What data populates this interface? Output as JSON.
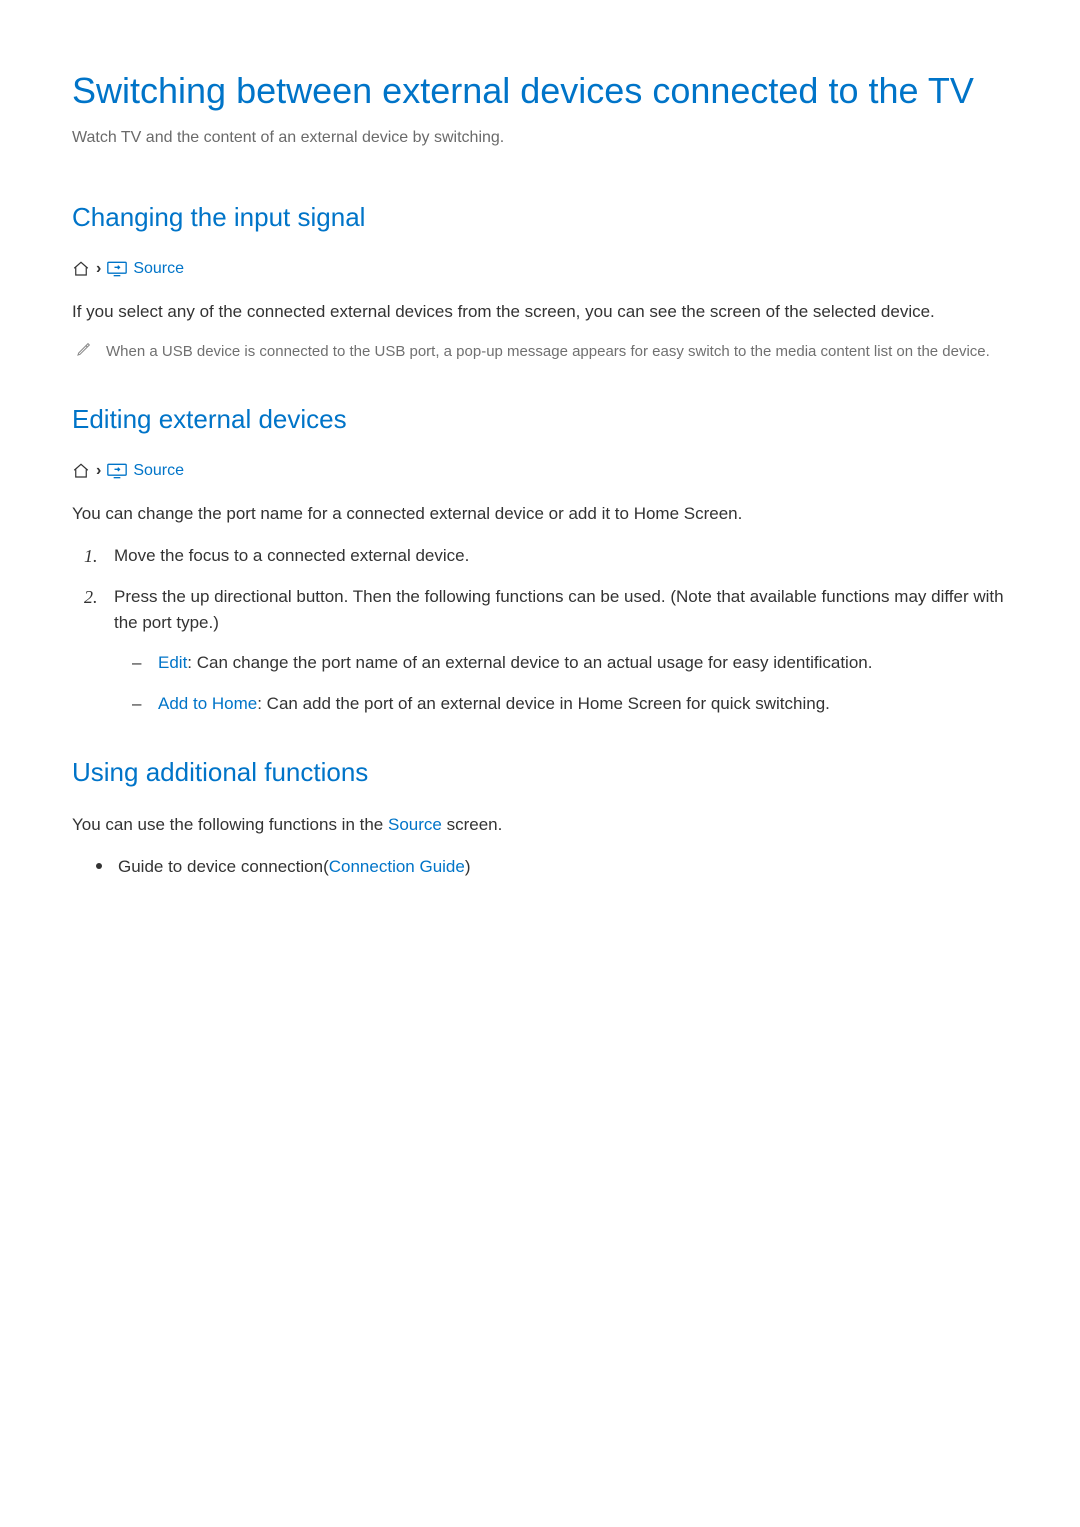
{
  "page": {
    "title": "Switching between external devices connected to the TV",
    "subtitle": "Watch TV and the content of an external device by switching."
  },
  "section1": {
    "heading": "Changing the input signal",
    "breadcrumb_label": "Source",
    "paragraph": "If you select any of the connected external devices from the screen, you can see the screen of the selected device.",
    "note": "When a USB device is connected to the USB port, a pop-up message appears for easy switch to the media content list on the device."
  },
  "section2": {
    "heading": "Editing external devices",
    "breadcrumb_label": "Source",
    "paragraph": "You can change the port name for a connected external device or add it to Home Screen.",
    "steps": {
      "s1": "Move the focus to a connected external device.",
      "s2": "Press the up directional button. Then the following functions can be used. (Note that available functions may differ with the port type.)",
      "sub_edit_keyword": "Edit",
      "sub_edit_rest": ": Can change the port name of an external device to an actual usage for easy identification.",
      "sub_addhome_keyword": "Add to Home",
      "sub_addhome_rest": ": Can add the port of an external device in Home Screen for quick switching."
    }
  },
  "section3": {
    "heading": "Using additional functions",
    "paragraph_pre": "You can use the following functions in the ",
    "paragraph_keyword": "Source",
    "paragraph_post": " screen.",
    "bullet_pre": "Guide to device connection(",
    "bullet_keyword": "Connection Guide",
    "bullet_post": ")"
  }
}
